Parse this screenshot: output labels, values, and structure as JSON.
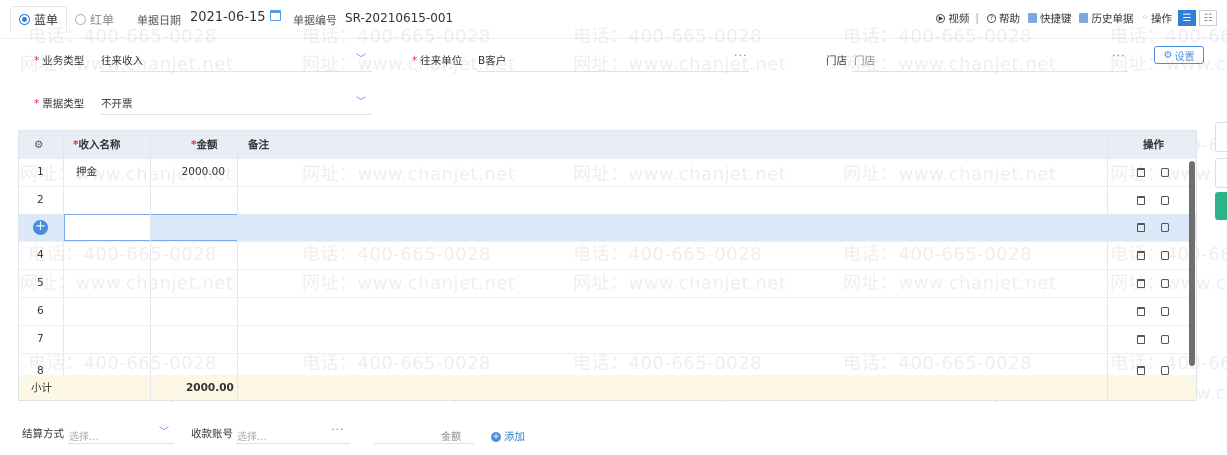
{
  "header": {
    "tabs": [
      {
        "label": "蓝单",
        "selected": true
      },
      {
        "label": "红单",
        "selected": false
      }
    ],
    "date_label": "单据日期",
    "date_value": "2021-06-15",
    "number_label": "单据编号",
    "number_value": "SR-20210615-001",
    "tools": {
      "video": "视频",
      "help": "帮助",
      "shortcuts": "快捷键",
      "history": "历史单据",
      "actions": "操作"
    }
  },
  "form": {
    "business_type": {
      "label": "业务类型",
      "value": "往来收入"
    },
    "counterparty": {
      "label": "往来单位",
      "value": "B客户"
    },
    "store": {
      "label": "门店",
      "value": "门店"
    },
    "invoice_type": {
      "label": "票据类型",
      "value": "不开票"
    },
    "settings_label": "设置"
  },
  "table": {
    "columns": {
      "income_name": "收入名称",
      "amount": "金额",
      "remark": "备注",
      "actions": "操作"
    },
    "rows": [
      {
        "no": "1",
        "income_name": "押金",
        "amount": "2000.00",
        "remark": ""
      },
      {
        "no": "2",
        "income_name": "",
        "amount": "",
        "remark": ""
      },
      {
        "no": "",
        "income_name": "",
        "amount": "",
        "remark": ""
      },
      {
        "no": "4",
        "income_name": "",
        "amount": "",
        "remark": ""
      },
      {
        "no": "5",
        "income_name": "",
        "amount": "",
        "remark": ""
      },
      {
        "no": "6",
        "income_name": "",
        "amount": "",
        "remark": ""
      },
      {
        "no": "7",
        "income_name": "",
        "amount": "",
        "remark": ""
      },
      {
        "no": "8",
        "income_name": "",
        "amount": "",
        "remark": ""
      }
    ],
    "subtotal_label": "小计",
    "subtotal_amount": "2000.00"
  },
  "settlement": {
    "method_label": "结算方式",
    "method_placeholder": "选择...",
    "account_label": "收款账号",
    "account_placeholder": "选择...",
    "amount_label": "金额",
    "add_label": "添加"
  },
  "watermark": {
    "phone": "电话：400-665-0028",
    "site": "网址：www.chanjet.net"
  },
  "colors": {
    "accent": "#2f7ed8",
    "selected_row": "#dce9f9",
    "subtotal_bg": "#fdf7e6",
    "required": "#e22233"
  }
}
